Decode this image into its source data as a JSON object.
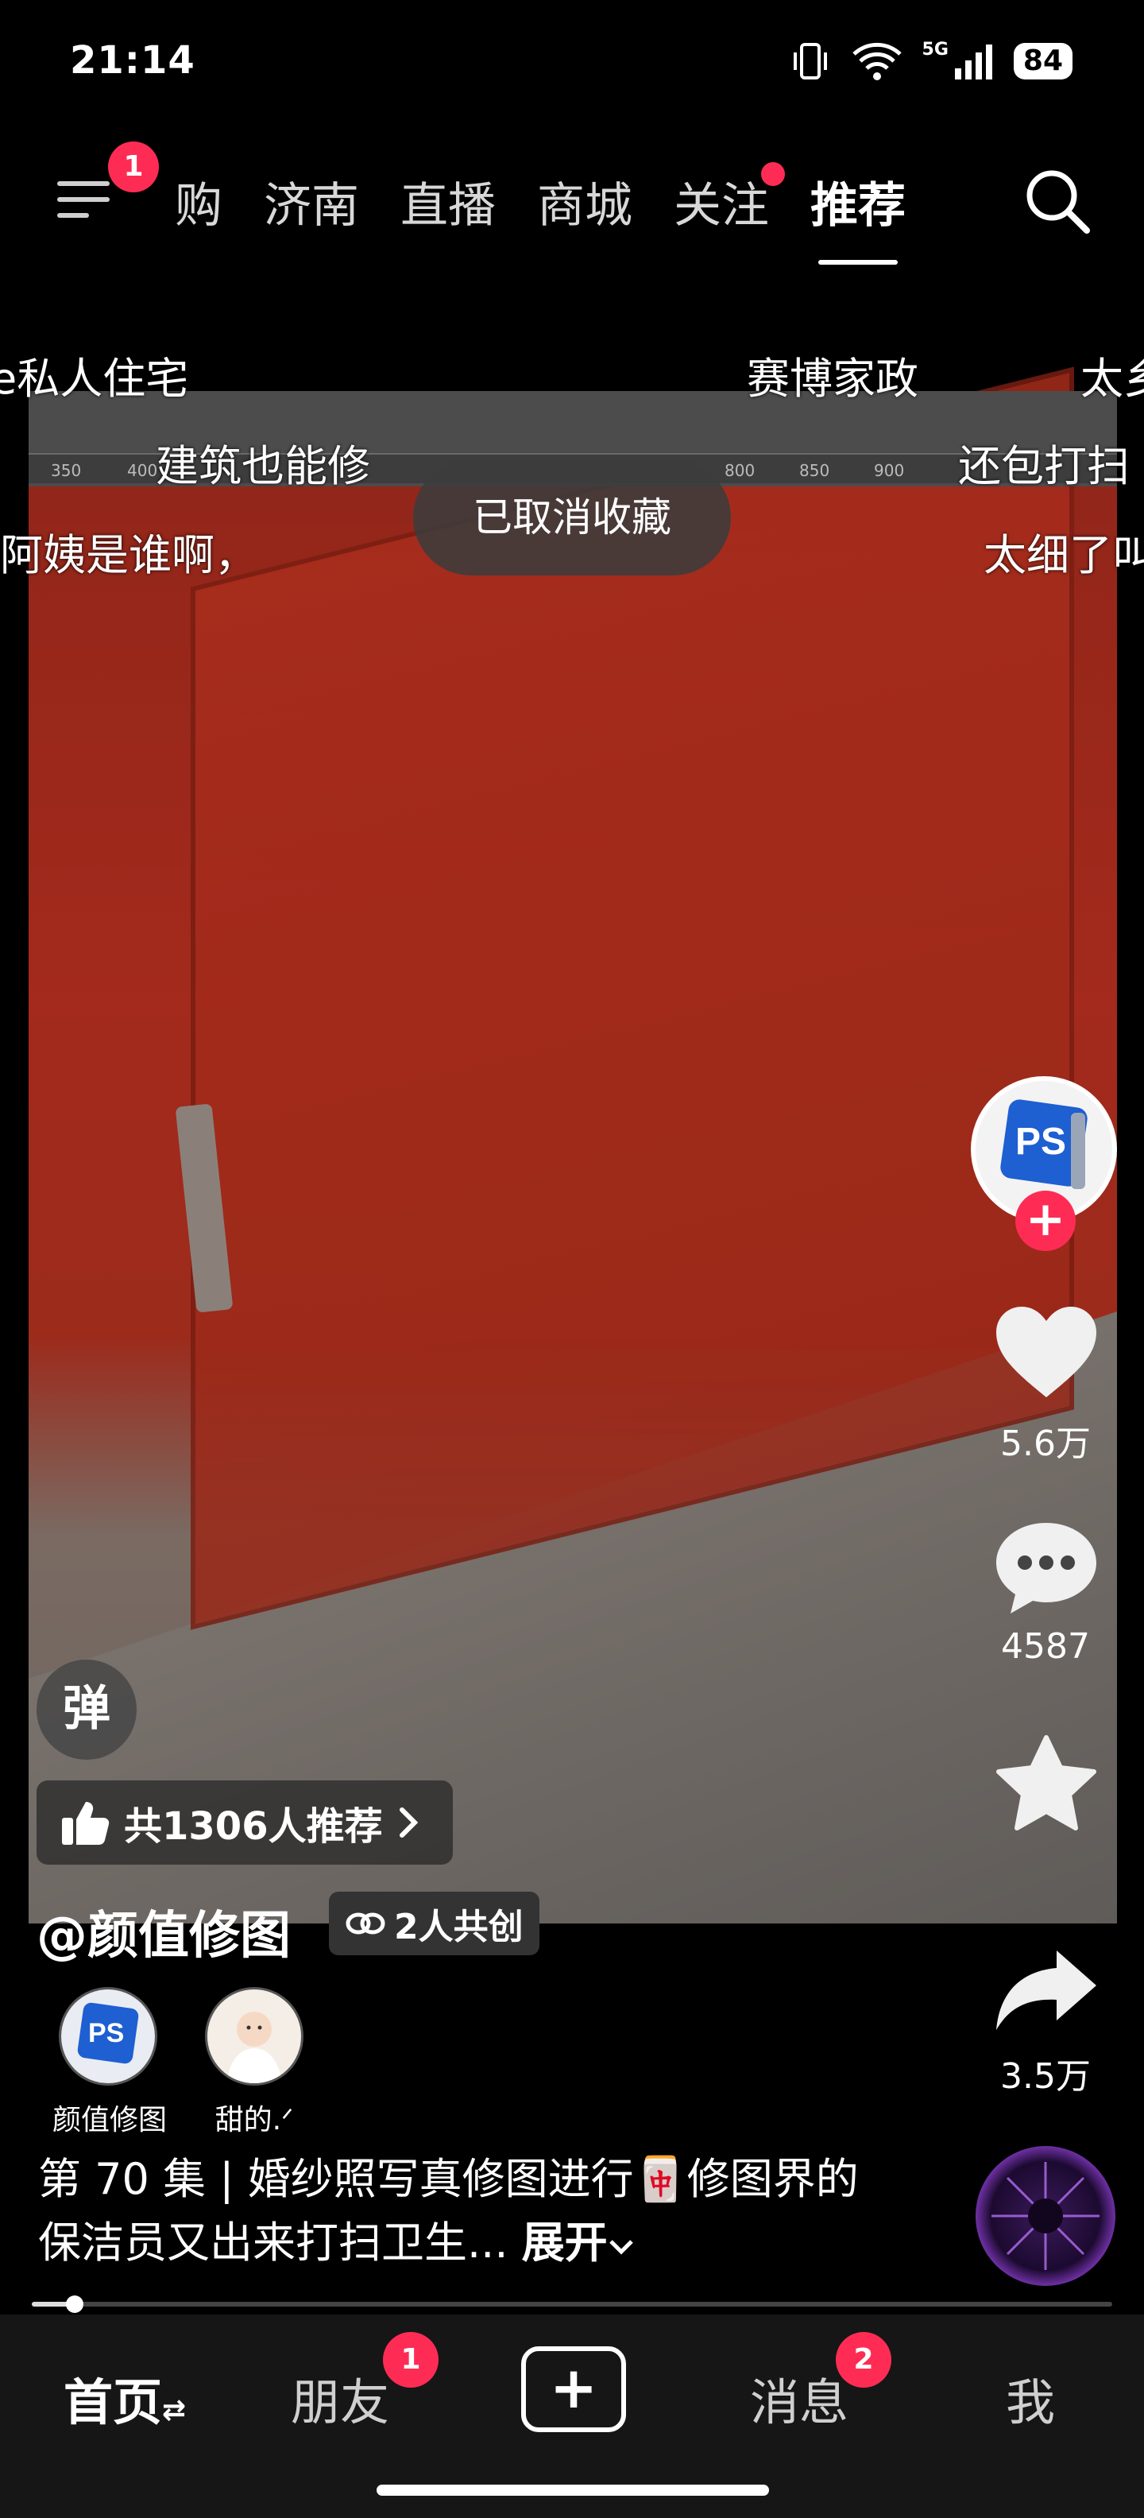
{
  "status_bar": {
    "time": "21:14",
    "network": "5G",
    "battery": "84"
  },
  "top_nav": {
    "menu_badge": "1",
    "tabs": [
      {
        "label": "购",
        "active": false
      },
      {
        "label": "济南",
        "active": false
      },
      {
        "label": "直播",
        "active": false
      },
      {
        "label": "商城",
        "active": false
      },
      {
        "label": "关注",
        "active": false,
        "dot": true
      },
      {
        "label": "推荐",
        "active": true
      }
    ]
  },
  "danmaku": [
    "e私人住宅",
    "赛博家政",
    "太乡",
    "建筑也能修",
    "还包打扫",
    "阿姨是谁啊，",
    "太细了叫"
  ],
  "ruler_ticks": [
    "350",
    "400",
    "800",
    "850",
    "900"
  ],
  "toast": "已取消收藏",
  "actions": {
    "likes": "5.6万",
    "comments": "4587",
    "shares": "3.5万"
  },
  "danmu_button": "弹",
  "recommend_text": "共1306人推荐",
  "author": "@颜值修图",
  "cocreate": "2人共创",
  "creators": [
    {
      "name": "颜值修图"
    },
    {
      "name": "甜的.ᐟ"
    }
  ],
  "caption": {
    "text": "第 70 集 | 婚纱照写真修图进行🀄修图界的保洁员又出来打扫卫生...",
    "expand": "展开"
  },
  "progress": 0.04,
  "bottom_tabs": {
    "home": "首页",
    "friends": "朋友",
    "friends_badge": "1",
    "messages": "消息",
    "messages_badge": "2",
    "me": "我"
  },
  "colors": {
    "accent": "#fe2c55",
    "background": "#000000",
    "tabbar": "#161616"
  }
}
